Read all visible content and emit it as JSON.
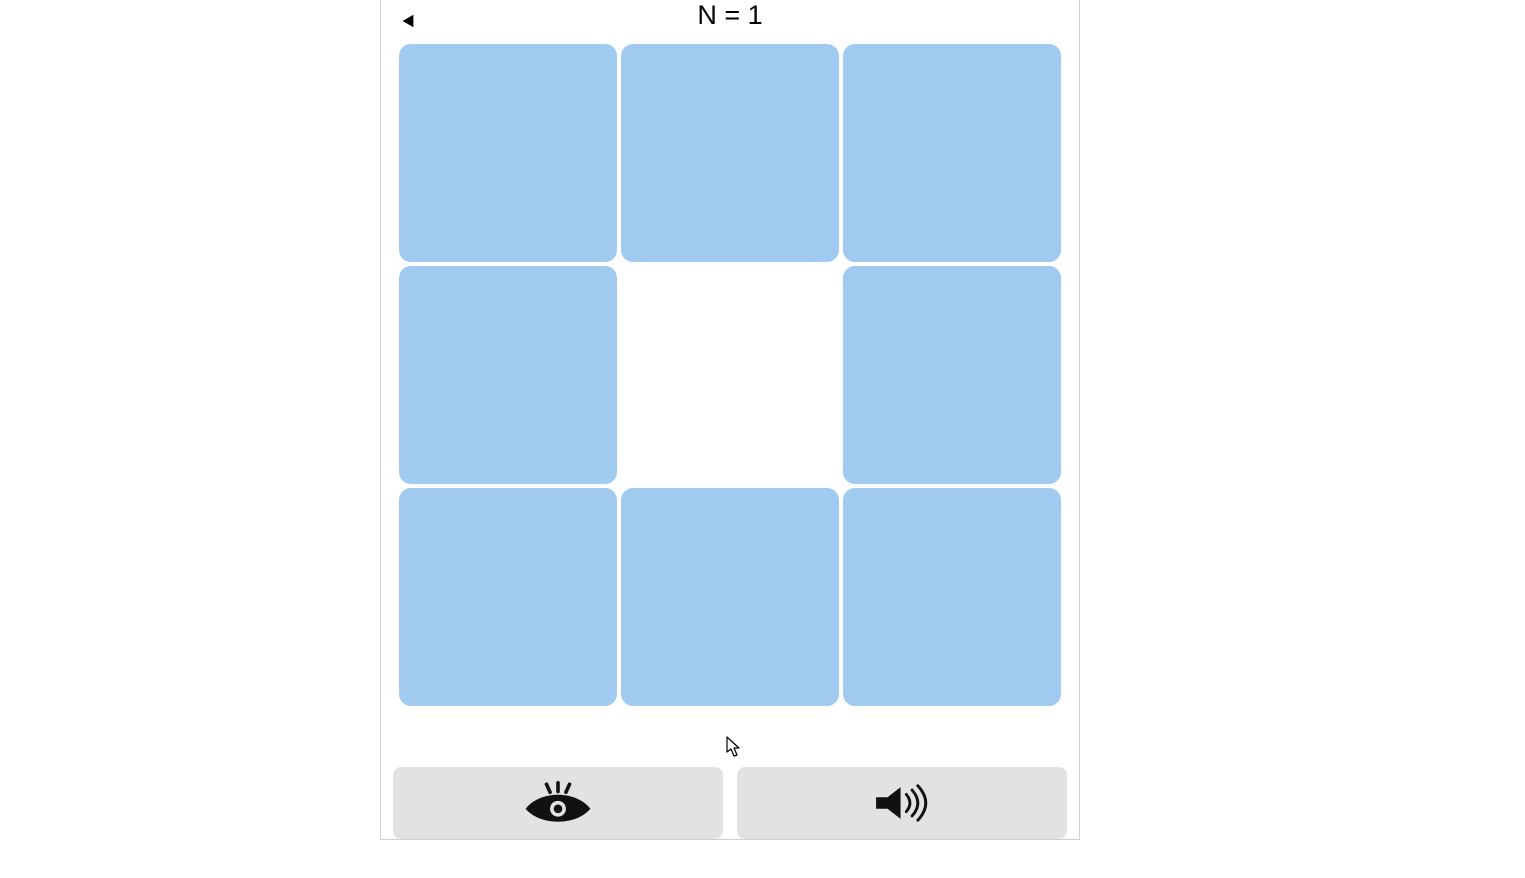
{
  "header": {
    "title": "N = 1"
  },
  "grid": {
    "cells": [
      {
        "filled": true
      },
      {
        "filled": true
      },
      {
        "filled": true
      },
      {
        "filled": true
      },
      {
        "filled": false
      },
      {
        "filled": true
      },
      {
        "filled": true
      },
      {
        "filled": true
      },
      {
        "filled": true
      }
    ],
    "cell_color": "#a1caf1"
  },
  "controls": {
    "visual_button": "eye-icon",
    "audio_button": "speaker-icon"
  }
}
